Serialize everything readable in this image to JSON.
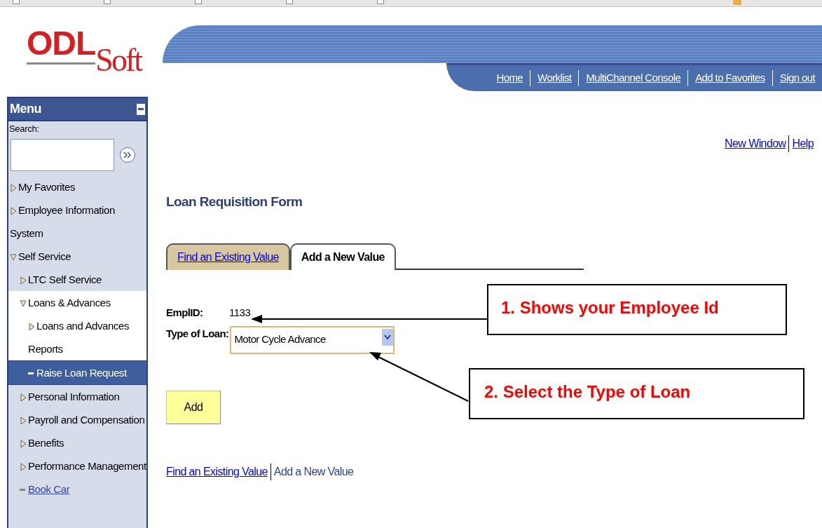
{
  "header": {
    "logo_main": "ODL",
    "logo_sub": "Soft",
    "nav_links": [
      "Home",
      "Worklist",
      "MultiChannel Console",
      "Add to Favorites",
      "Sign out"
    ]
  },
  "sidebar": {
    "title": "Menu",
    "search_label": "Search:",
    "items": [
      {
        "label": "My Favorites",
        "kind": "folder",
        "expanded": false,
        "selected": false
      },
      {
        "label": "Employee Information System",
        "kind": "folder",
        "expanded": false,
        "selected": false
      },
      {
        "label": "Self Service",
        "kind": "folder",
        "expanded": true,
        "selected": false,
        "children": [
          {
            "label": "LTC Self Service",
            "kind": "folder",
            "expanded": false,
            "selected": false
          },
          {
            "label": "Loans & Advances",
            "kind": "folder",
            "expanded": true,
            "selected": false,
            "children": [
              {
                "label": "Loans and Advances Reports",
                "kind": "folder",
                "expanded": false,
                "selected": false
              },
              {
                "label": "Raise Loan Request",
                "kind": "leaf",
                "selected": true
              }
            ]
          },
          {
            "label": "Personal Information",
            "kind": "folder",
            "expanded": false,
            "selected": false
          },
          {
            "label": "Payroll and Compensation",
            "kind": "folder",
            "expanded": false,
            "selected": false
          },
          {
            "label": "Benefits",
            "kind": "folder",
            "expanded": false,
            "selected": false
          },
          {
            "label": "Performance Management",
            "kind": "folder",
            "expanded": false,
            "selected": false
          },
          {
            "label": "Book Car",
            "kind": "leaf",
            "selected": false
          }
        ]
      }
    ]
  },
  "page_links": [
    "New Window",
    "Help"
  ],
  "form": {
    "title": "Loan Requisition Form",
    "tabs": [
      {
        "label": "Find an Existing Value",
        "selected": false
      },
      {
        "label": "Add a New Value",
        "selected": true
      }
    ],
    "fields": [
      {
        "label": "EmplID:",
        "kind": "text",
        "value": "1133"
      },
      {
        "label": "Type of Loan:",
        "kind": "select",
        "value": "Motor Cycle Advance"
      }
    ],
    "add_button": "Add",
    "bottom_links": [
      "Find an Existing Value",
      "Add a New Value"
    ]
  },
  "callouts": [
    "1. Shows your Employee Id",
    "2. Select the Type of Loan"
  ]
}
